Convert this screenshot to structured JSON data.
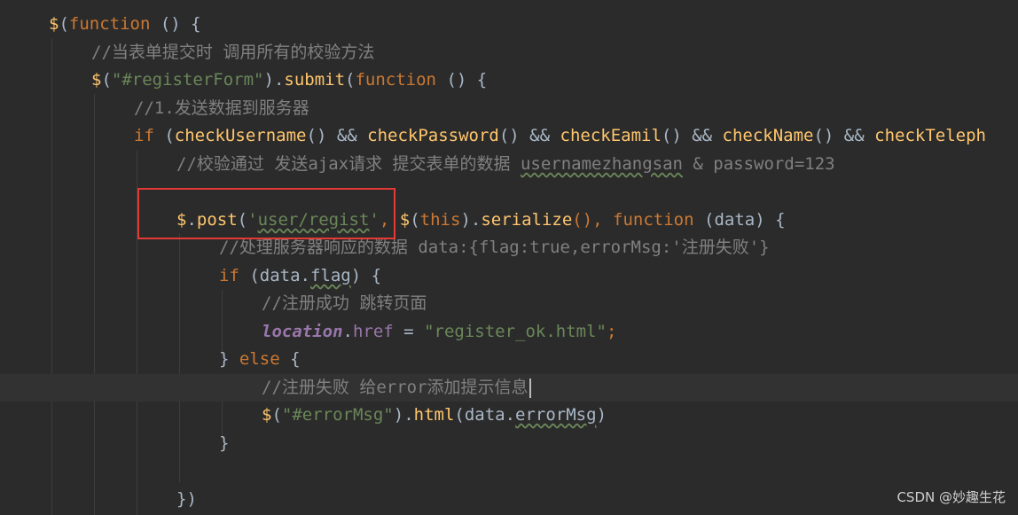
{
  "colors": {
    "background": "#2b2b2b",
    "function": "#ffc66d",
    "keyword": "#cc7832",
    "string": "#6a8759",
    "comment": "#808080",
    "variable": "#9876aa",
    "text": "#a9b7c6",
    "highlight_box": "#e53935"
  },
  "code": {
    "l1": {
      "p1": "$",
      "p2": "(",
      "p3": "function",
      "p4": " () {"
    },
    "l2": {
      "comment": "//当表单提交时 调用所有的校验方法"
    },
    "l3": {
      "p1": "$",
      "p2": "(",
      "p3": "\"#registerForm\"",
      "p4": ").",
      "p5": "submit",
      "p6": "(",
      "p7": "function",
      "p8": " () {"
    },
    "l4": {
      "comment": "//1.发送数据到服务器"
    },
    "l5": {
      "p1": "if",
      "p2": " (",
      "p3": "checkUsername",
      "p4": "() && ",
      "p5": "checkPassword",
      "p6": "() && ",
      "p7": "checkEamil",
      "p8": "() && ",
      "p9": "checkName",
      "p10": "() && ",
      "p11": "checkTeleph"
    },
    "l6": {
      "p1": "//校验通过 发送ajax请求 提交表单的数据 ",
      "p2": "usernamezhangsan",
      "p3": " & password=123"
    },
    "l7": {
      "p1": "$",
      "p2": ".",
      "p3": "post",
      "p4": "(",
      "p5": "'",
      "p6": "user/regist",
      "p7": "'",
      "p8": ", ",
      "p9": "$",
      "p10": "(",
      "p11": "this",
      "p12": ").",
      "p13": "serialize",
      "p14": "(), ",
      "p15": "function",
      "p16": " (data) {"
    },
    "l8": {
      "comment": "//处理服务器响应的数据 data:{flag:true,errorMsg:'注册失败'}"
    },
    "l9": {
      "p1": "if",
      "p2": " (data.",
      "p3": "flag",
      "p4": ") {"
    },
    "l10": {
      "comment": "//注册成功 跳转页面"
    },
    "l11": {
      "p1": "location",
      "p2": ".",
      "p3": "href",
      "p4": " = ",
      "p5": "\"register_ok.html\"",
      "p6": ";"
    },
    "l12": {
      "p1": "} ",
      "p2": "else",
      "p3": " {"
    },
    "l13": {
      "comment": "//注册失败 给error添加提示信息"
    },
    "l14": {
      "p1": "$",
      "p2": "(",
      "p3": "\"#errorMsg\"",
      "p4": ").",
      "p5": "html",
      "p6": "(data.",
      "p7": "errorMsg",
      "p8": ")"
    },
    "l15": {
      "p1": "}"
    },
    "l16": {
      "p1": "})"
    }
  },
  "watermark": "CSDN @妙趣生花"
}
